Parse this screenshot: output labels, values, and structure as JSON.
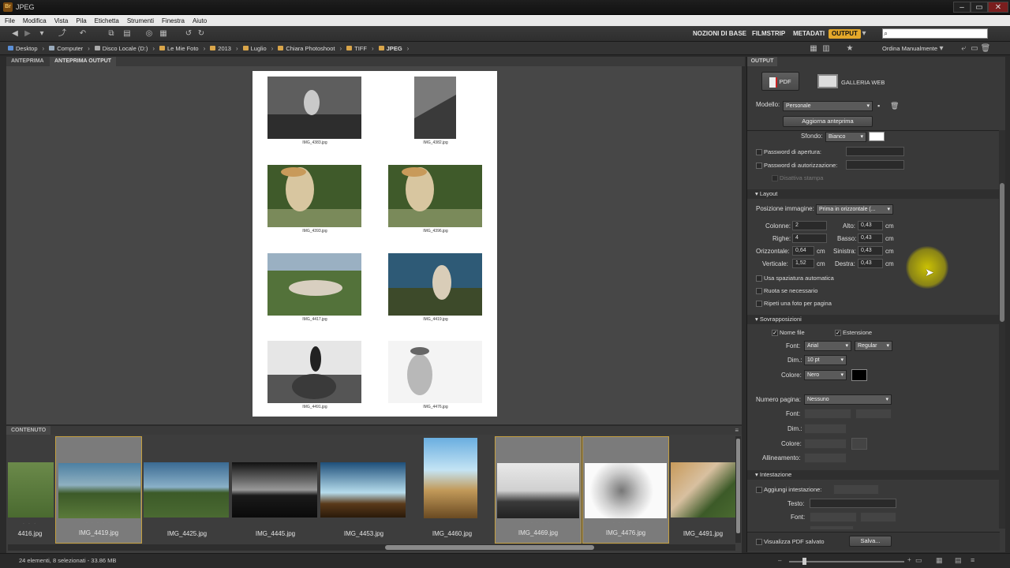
{
  "window": {
    "title": "JPEG"
  },
  "menu": [
    "File",
    "Modifica",
    "Vista",
    "Pila",
    "Etichetta",
    "Strumenti",
    "Finestra",
    "Aiuto"
  ],
  "workspaces": [
    "NOZIONI DI BASE",
    "FILMSTRIP",
    "METADATI",
    "OUTPUT"
  ],
  "breadcrumb": [
    "Desktop",
    "Computer",
    "Disco Locale (D:)",
    "Le Mie Foto",
    "2013",
    "Luglio",
    "Chiara Photoshoot",
    "TIFF",
    "JPEG"
  ],
  "sort_label": "Ordina Manualmente",
  "left_tabs": [
    "ANTEPRIMA",
    "ANTEPRIMA OUTPUT"
  ],
  "page_captions": [
    "IMG_4383.jpg",
    "IMG_4382.jpg",
    "IMG_4393.jpg",
    "IMG_4396.jpg",
    "IMG_4417.jpg",
    "IMG_4419.jpg",
    "IMG_4491.jpg",
    "IMG_4476.jpg"
  ],
  "content": {
    "header": "CONTENUTO",
    "items": [
      "4416.jpg",
      "IMG_4419.jpg",
      "IMG_4425.jpg",
      "IMG_4445.jpg",
      "IMG_4453.jpg",
      "IMG_4460.jpg",
      "IMG_4469.jpg",
      "IMG_4476.jpg",
      "IMG_4491.jpg"
    ]
  },
  "status": "24 elementi, 8 selezionati - 33.86 MB",
  "output": {
    "tab": "OUTPUT",
    "pdf_label": "PDF",
    "web_label": "GALLERIA WEB",
    "modello_label": "Modello:",
    "modello_value": "Personale",
    "refresh_btn": "Aggiorna anteprima",
    "sfondo_label": "Sfondo:",
    "sfondo_value": "Bianco",
    "pw_open": "Password di apertura:",
    "pw_auth": "Password di autorizzazione:",
    "disable_print": "Disattiva stampa",
    "layout_hdr": "Layout",
    "pos_label": "Posizione immagine:",
    "pos_value": "Prima in orizzontale (...",
    "colonne_label": "Colonne:",
    "colonne": "2",
    "righe_label": "Righe:",
    "righe": "4",
    "orizz_label": "Orizzontale:",
    "orizz": "0,64",
    "vert_label": "Verticale:",
    "vert": "1,52",
    "alto_label": "Alto:",
    "alto": "0,43",
    "basso_label": "Basso:",
    "basso": "0,43",
    "sinistra_label": "Sinistra:",
    "sinistra": "0,43",
    "destra_label": "Destra:",
    "destra": "0,43",
    "unit": "cm",
    "auto_space": "Usa spaziatura automatica",
    "rotate": "Ruota se necessario",
    "repeat": "Ripeti una foto per pagina",
    "overlay_hdr": "Sovrapposizioni",
    "nome_file": "Nome file",
    "estensione": "Estensione",
    "font_label": "Font:",
    "font_value": "Arial",
    "style_value": "Regular",
    "dim_label": "Dim.:",
    "dim_value": "10 pt",
    "colore_label": "Colore:",
    "colore_value": "Nero",
    "page_num_label": "Numero pagina:",
    "page_num_value": "Nessuno",
    "allineamento_label": "Allineamento:",
    "intest_hdr": "Intestazione",
    "add_header": "Aggiungi intestazione:",
    "testo_label": "Testo:",
    "view_pdf": "Visualizza PDF salvato",
    "save_btn": "Salva..."
  },
  "colors": {
    "accent": "#e4a82a",
    "selection_border": "#c5a040"
  }
}
